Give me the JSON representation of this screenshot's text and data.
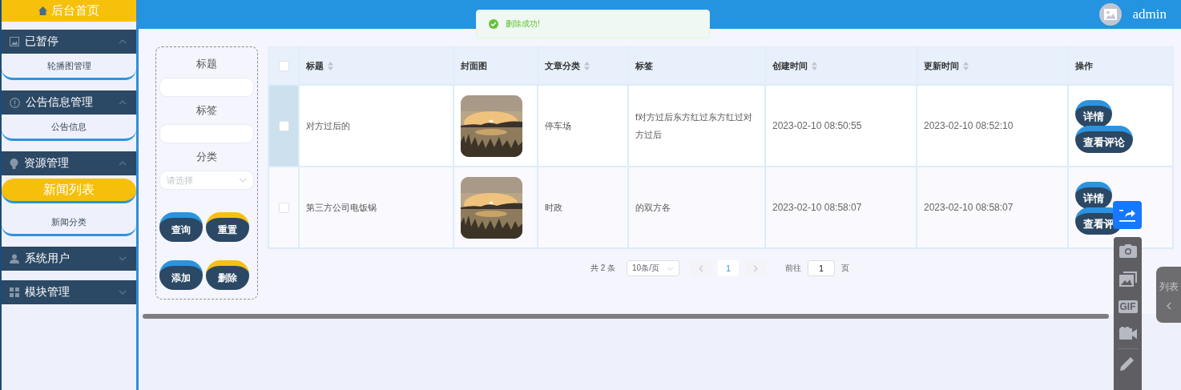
{
  "sidebar": {
    "home": "后台首页",
    "groups": [
      {
        "title": "已暂停",
        "expanded": true,
        "items": [
          {
            "label": "轮播图管理",
            "selected": false
          }
        ]
      },
      {
        "title": "公告信息管理",
        "expanded": true,
        "items": [
          {
            "label": "公告信息",
            "selected": false
          }
        ]
      },
      {
        "title": "资源管理",
        "expanded": true,
        "items": [
          {
            "label": "新闻列表",
            "selected": true
          },
          {
            "label": "新闻分类",
            "selected": false
          }
        ]
      },
      {
        "title": "系统用户",
        "expanded": false
      },
      {
        "title": "模块管理",
        "expanded": false
      }
    ]
  },
  "header": {
    "user": "admin"
  },
  "toast": {
    "message": "删除成功!"
  },
  "filter": {
    "fields": [
      {
        "label": "标题",
        "kind": "text"
      },
      {
        "label": "标签",
        "kind": "text"
      },
      {
        "label": "分类",
        "kind": "select",
        "placeholder": "请选择"
      }
    ],
    "buttons": [
      {
        "label": "查询",
        "color": "#2b93e0"
      },
      {
        "label": "重置",
        "color": "#f5c00f"
      },
      {
        "label": "添加",
        "color": "#2b93e0"
      },
      {
        "label": "删除",
        "color": "#f5c00f"
      }
    ]
  },
  "table": {
    "header_checked": false,
    "columns": [
      {
        "label": "标题",
        "sortable": true
      },
      {
        "label": "封面图",
        "sortable": false
      },
      {
        "label": "文章分类",
        "sortable": true
      },
      {
        "label": "标签",
        "sortable": false
      },
      {
        "label": "创建时间",
        "sortable": true
      },
      {
        "label": "更新时间",
        "sortable": true
      },
      {
        "label": "操作",
        "sortable": false
      }
    ],
    "rows": [
      {
        "checked": false,
        "title": "对方过后的",
        "cover": {
          "kind": "picture"
        },
        "category": "停车场",
        "tags": "f对方过后东方红过东方红过对方过后",
        "created": "2023-02-10 08:50:55",
        "updated": "2023-02-10 08:52:10",
        "actions": [
          "详情",
          "查看评论"
        ]
      },
      {
        "checked": false,
        "title": "第三方公司电饭锅",
        "cover": {
          "kind": "picture"
        },
        "category": "时政",
        "tags": "的双方各",
        "created": "2023-02-10 08:58:07",
        "updated": "2023-02-10 08:58:07",
        "actions": [
          "详情",
          "查看评"
        ]
      }
    ]
  },
  "pagination": {
    "total": "共 2 条",
    "page_size": "10条/页",
    "pages": [
      {
        "label": "1",
        "selected": true
      }
    ],
    "goto_label": "前往",
    "goto_value": "1",
    "page_suffix": "页"
  },
  "capture_toolbar": {
    "tools": [
      {
        "kind": "camera"
      },
      {
        "kind": "images"
      },
      {
        "kind": "gif",
        "label": "GIF"
      },
      {
        "kind": "video"
      },
      {
        "kind": "pencil"
      }
    ]
  },
  "side_tab": {
    "label": "列表"
  }
}
